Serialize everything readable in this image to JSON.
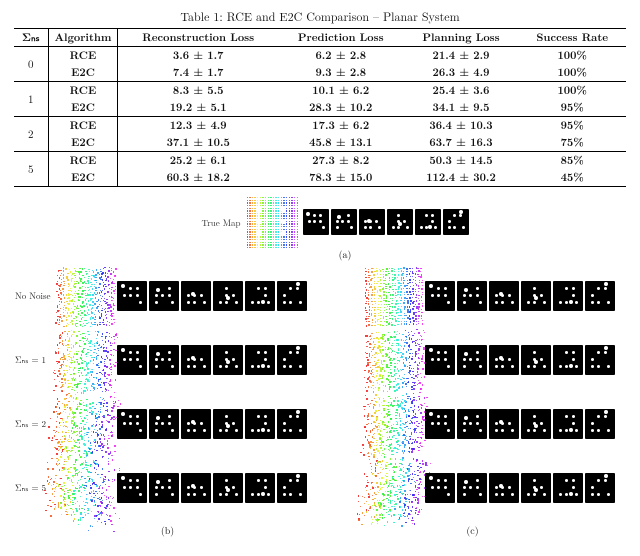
{
  "table": {
    "caption": "Table 1: RCE and E2C Comparison – Planar System",
    "headers": [
      "Σ",
      "Algorithm",
      "Reconstruction Loss",
      "Prediction Loss",
      "Planning Loss",
      "Success Rate"
    ],
    "sigma_header_tex": "Σₙₛ",
    "groups": [
      {
        "sigma": "0",
        "rows": [
          {
            "alg": "RCE",
            "rec": "3.6 ± 1.7",
            "pred": "6.2 ± 2.8",
            "plan": "21.4 ± 2.9",
            "succ": "100%",
            "bold": true
          },
          {
            "alg": "E2C",
            "rec": "7.4 ± 1.7",
            "pred": "9.3 ± 2.8",
            "plan": "26.3 ± 4.9",
            "succ": "100%",
            "bold": true
          }
        ]
      },
      {
        "sigma": "1",
        "rows": [
          {
            "alg": "RCE",
            "rec": "8.3 ± 5.5",
            "pred": "10.1 ± 6.2",
            "plan": "25.4 ± 3.6",
            "succ": "100%",
            "bold": true
          },
          {
            "alg": "E2C",
            "rec": "19.2 ± 5.1",
            "pred": "28.3 ± 10.2",
            "plan": "34.1 ± 9.5",
            "succ": "95%",
            "bold": true
          }
        ]
      },
      {
        "sigma": "2",
        "rows": [
          {
            "alg": "RCE",
            "rec": "12.3 ± 4.9",
            "pred": "17.3 ± 6.2",
            "plan": "36.4 ± 10.3",
            "succ": "95%",
            "bold": true
          },
          {
            "alg": "E2C",
            "rec": "37.1 ± 10.5",
            "pred": "45.8 ± 13.1",
            "plan": "63.7 ± 16.3",
            "succ": "75%",
            "bold": true
          }
        ]
      },
      {
        "sigma": "5",
        "rows": [
          {
            "alg": "RCE",
            "rec": "25.2 ± 6.1",
            "pred": "27.3 ± 8.2",
            "plan": "50.3 ± 14.5",
            "succ": "85%",
            "bold": true
          },
          {
            "alg": "E2C",
            "rec": "60.3 ± 18.2",
            "pred": "78.3 ± 15.0",
            "plan": "112.4 ± 30.2",
            "succ": "45%",
            "bold": true
          }
        ]
      }
    ]
  },
  "figure": {
    "true_map_label": "True Map",
    "sub_a": "(a)",
    "sub_b": "(b)",
    "sub_c": "(c)",
    "row_labels": [
      "No Noise",
      "Σₙₛ = 1",
      "Σₙₛ = 2",
      "Σₙₛ = 5"
    ],
    "tiles_per_seq": 6,
    "dot_pattern": [
      [
        12,
        6
      ],
      [
        19,
        6
      ],
      [
        6,
        13
      ],
      [
        12,
        13
      ],
      [
        19,
        13
      ],
      [
        22,
        20
      ],
      [
        6,
        20
      ],
      [
        12,
        20
      ]
    ]
  }
}
